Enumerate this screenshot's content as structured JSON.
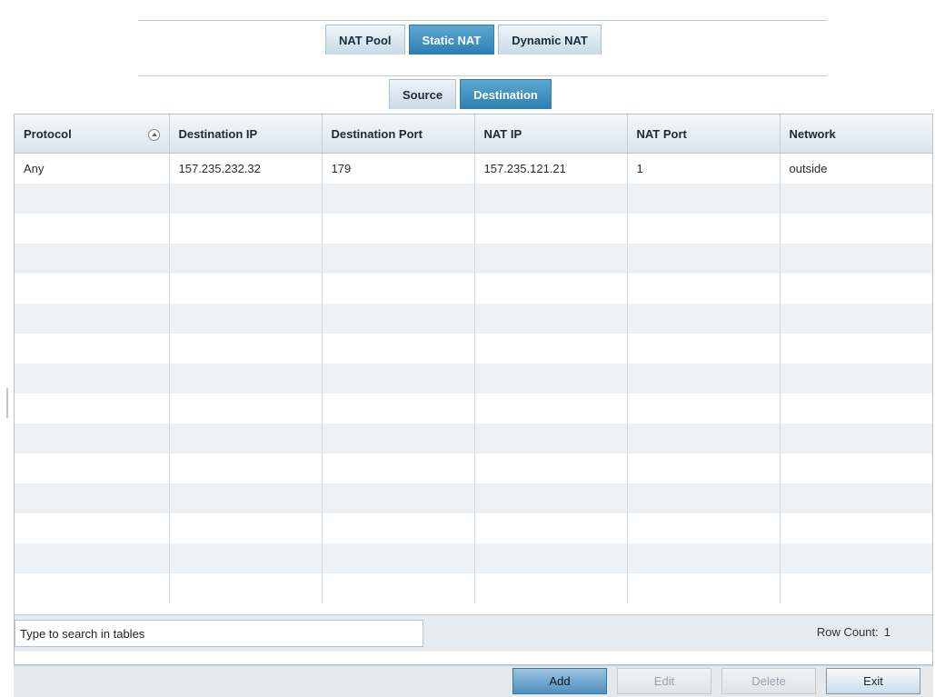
{
  "nat_tabs": [
    {
      "label": "NAT Pool",
      "active": false
    },
    {
      "label": "Static NAT",
      "active": true
    },
    {
      "label": "Dynamic NAT",
      "active": false
    }
  ],
  "direction_tabs": [
    {
      "label": "Source",
      "active": false
    },
    {
      "label": "Destination",
      "active": true
    }
  ],
  "table": {
    "columns": [
      "Protocol",
      "Destination IP",
      "Destination Port",
      "NAT IP",
      "NAT Port",
      "Network"
    ],
    "rows": [
      [
        "Any",
        "157.235.232.32",
        "179",
        "157.235.121.21",
        "1",
        "outside"
      ]
    ],
    "empty_rows": 14
  },
  "search": {
    "placeholder": "Type to search in tables",
    "value": "Type to search in tables"
  },
  "row_count": {
    "label": "Row Count:",
    "value": "1"
  },
  "buttons": {
    "add": "Add",
    "edit": "Edit",
    "delete": "Delete",
    "exit": "Exit"
  },
  "colors": {
    "active_tab": "#2c7fb2",
    "header_bg": "#d9e5ed",
    "alt_row": "#eef1f3"
  }
}
